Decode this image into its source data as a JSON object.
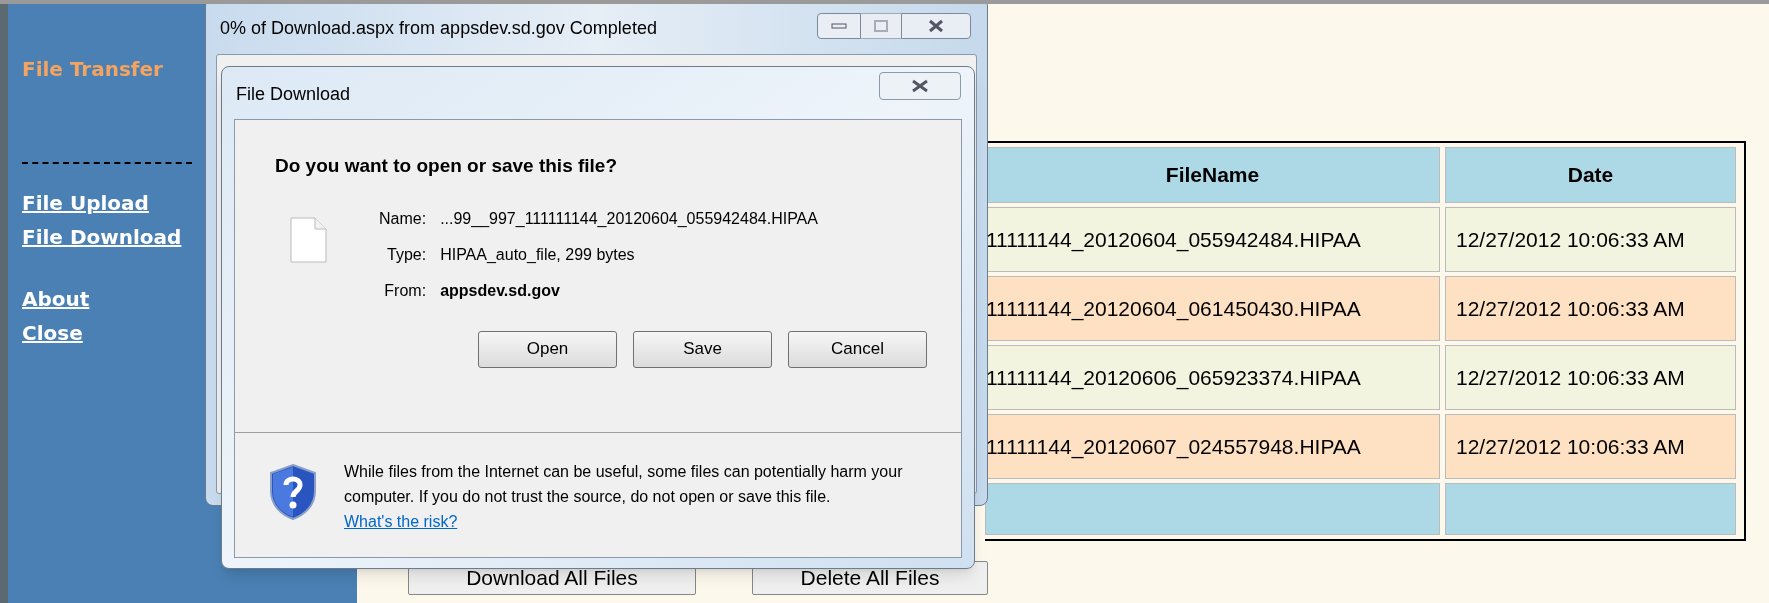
{
  "sidebar": {
    "title": "File Transfer",
    "link_groups": [
      [
        {
          "label": "File Upload"
        },
        {
          "label": "File Download"
        }
      ],
      [
        {
          "label": "About"
        },
        {
          "label": "Close"
        }
      ]
    ]
  },
  "table": {
    "columns": [
      "FileName",
      "Date"
    ],
    "rows": [
      {
        "cells": [
          "11111144_20120604_055942484.HIPAA",
          "12/27/2012 10:06:33 AM"
        ]
      },
      {
        "cells": [
          "11111144_20120604_061450430.HIPAA",
          "12/27/2012 10:06:33 AM"
        ]
      },
      {
        "cells": [
          "11111144_20120606_065923374.HIPAA",
          "12/27/2012 10:06:33 AM"
        ]
      },
      {
        "cells": [
          "11111144_20120607_024557948.HIPAA",
          "12/27/2012 10:06:33 AM"
        ]
      }
    ]
  },
  "buttons": [
    "Download All Files",
    "Delete All Files"
  ],
  "progress_window": {
    "title": "0% of Download.aspx from appsdev.sd.gov Completed"
  },
  "dialog": {
    "title": "File Download",
    "question": "Do you want to open or save this file?",
    "fields": [
      {
        "label": "Name:",
        "value": "...99__997_111111144_20120604_055942484.HIPAA",
        "bold": false
      },
      {
        "label": "Type:",
        "value": "HIPAA_auto_file, 299 bytes",
        "bold": false
      },
      {
        "label": "From:",
        "value": "appsdev.sd.gov",
        "bold": true
      }
    ],
    "buttons": [
      "Open",
      "Save",
      "Cancel"
    ],
    "warning": "While files from the Internet can be useful, some files can potentially harm your computer. If you do not trust the source, do not open or save this file.",
    "link": "What's the risk?"
  }
}
